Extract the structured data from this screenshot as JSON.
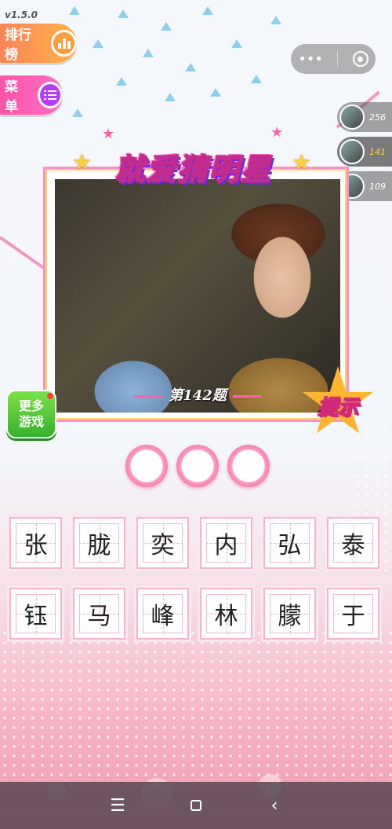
{
  "app": {
    "version": "v1.5.0",
    "title": "就爱猜明星",
    "accent": "#ff5fb0"
  },
  "left_buttons": {
    "rank_label": "排行榜",
    "rank_icon": "ranking-icon",
    "menu_label": "菜单",
    "menu_icon": "list-icon"
  },
  "capsule": {
    "more_icon": "more-dots-icon",
    "close_icon": "target-icon"
  },
  "players": [
    {
      "rank": "256"
    },
    {
      "rank": "141",
      "self": true
    },
    {
      "rank": "109"
    }
  ],
  "question": {
    "label": "第142题",
    "number": 142
  },
  "buttons": {
    "more_games": "更多\n游戏",
    "hint": "提示"
  },
  "answer_slots": 3,
  "characters": [
    "张",
    "胧",
    "奕",
    "内",
    "弘",
    "泰",
    "钰",
    "马",
    "峰",
    "林",
    "朦",
    "于"
  ],
  "navbar": {
    "menu_icon": "☰",
    "home_icon": "square-icon",
    "back_icon": "‹"
  }
}
